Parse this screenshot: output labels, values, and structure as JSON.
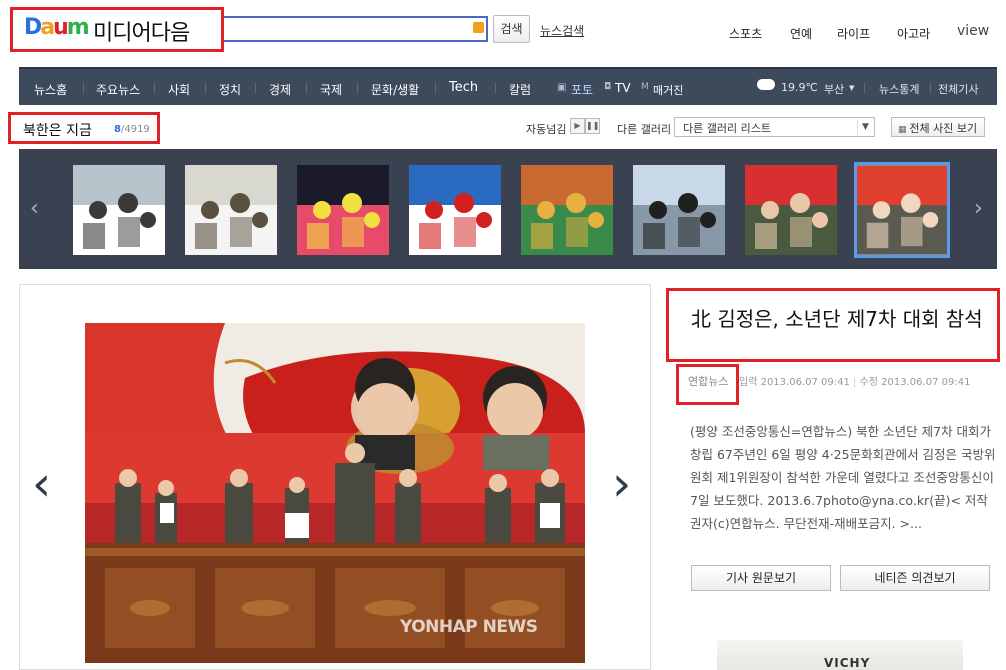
{
  "header": {
    "logo_brand": "DAUM",
    "logo_letters": [
      "D",
      "a",
      "u",
      "m"
    ],
    "logo_text": "미디어다음",
    "search_button": "검색",
    "news_search": "뉴스검색",
    "top_nav": [
      "스포츠",
      "연예",
      "라이프",
      "아고라",
      "view"
    ]
  },
  "gnb": {
    "items": [
      "뉴스홈",
      "주요뉴스",
      "사회",
      "정치",
      "경제",
      "국제",
      "문화/생활",
      "Tech",
      "칼럼"
    ],
    "media": [
      "포토",
      "TV",
      "매거진"
    ],
    "weather_temp": "19.9℃",
    "weather_city": "부산",
    "right_links": [
      "뉴스통계",
      "전체기사"
    ]
  },
  "gallery": {
    "title": "북한은 지금",
    "current": "8",
    "total": "/4919",
    "autoplay_label": "자동넘김",
    "other_gallery_label": "다른 갤러리",
    "select_value": "다른 갤러리 리스트",
    "all_photos_button": "전체 사진 보기",
    "thumbnails": [
      {
        "name": "crowd-white-caps",
        "sky": "#b8c4cc",
        "main": "#ffffff",
        "accent": "#3a3a3a"
      },
      {
        "name": "crowd-soldiers",
        "sky": "#d8d8d0",
        "main": "#f4f4f4",
        "accent": "#5a5040"
      },
      {
        "name": "performer-stage",
        "sky": "#1a1a2a",
        "main": "#e84a6a",
        "accent": "#f0e040"
      },
      {
        "name": "audience-blue",
        "sky": "#2a6ac0",
        "main": "#ffffff",
        "accent": "#d02020"
      },
      {
        "name": "performance-tiger",
        "sky": "#c86a30",
        "main": "#3a8a4a",
        "accent": "#e8b040"
      },
      {
        "name": "gate-building",
        "sky": "#c8d8e8",
        "main": "#8898a8",
        "accent": "#202020"
      },
      {
        "name": "officials-red",
        "sky": "#d83030",
        "main": "#4a5a40",
        "accent": "#e8c8a8"
      },
      {
        "name": "stage-portraits",
        "sky": "#e04030",
        "main": "#5a5a50",
        "accent": "#f0d8c0"
      }
    ]
  },
  "article": {
    "headline": "北 김정은, 소년단 제7차 대회 참석",
    "source": "연합뉴스",
    "input_date": "입력 2013.06.07 09:41",
    "modified_date": "수정 2013.06.07 09:41",
    "summary": "(평양 조선중앙통신=연합뉴스) 북한 소년단 제7차 대회가 창립 67주년인 6일 평양 4·25문화회관에서 김정은 국방위원회 제1위원장이 참석한 가운데 열렸다고 조선중앙통신이 7일 보도했다. 2013.6.7photo@yna.co.kr(끝)< 저작권자(c)연합뉴스. 무단전재-재배포금지. >...",
    "original_button": "기사 원문보기",
    "opinion_button": "네티즌 의견보기",
    "watermark": "YONHAP NEWS"
  },
  "ad": {
    "text": "VICHY"
  },
  "colors": {
    "accent_blue": "#2a6ee0",
    "gnb_bg": "#3d4a5c",
    "filmstrip_bg": "#3a4252",
    "highlight_red": "#e0202a"
  }
}
